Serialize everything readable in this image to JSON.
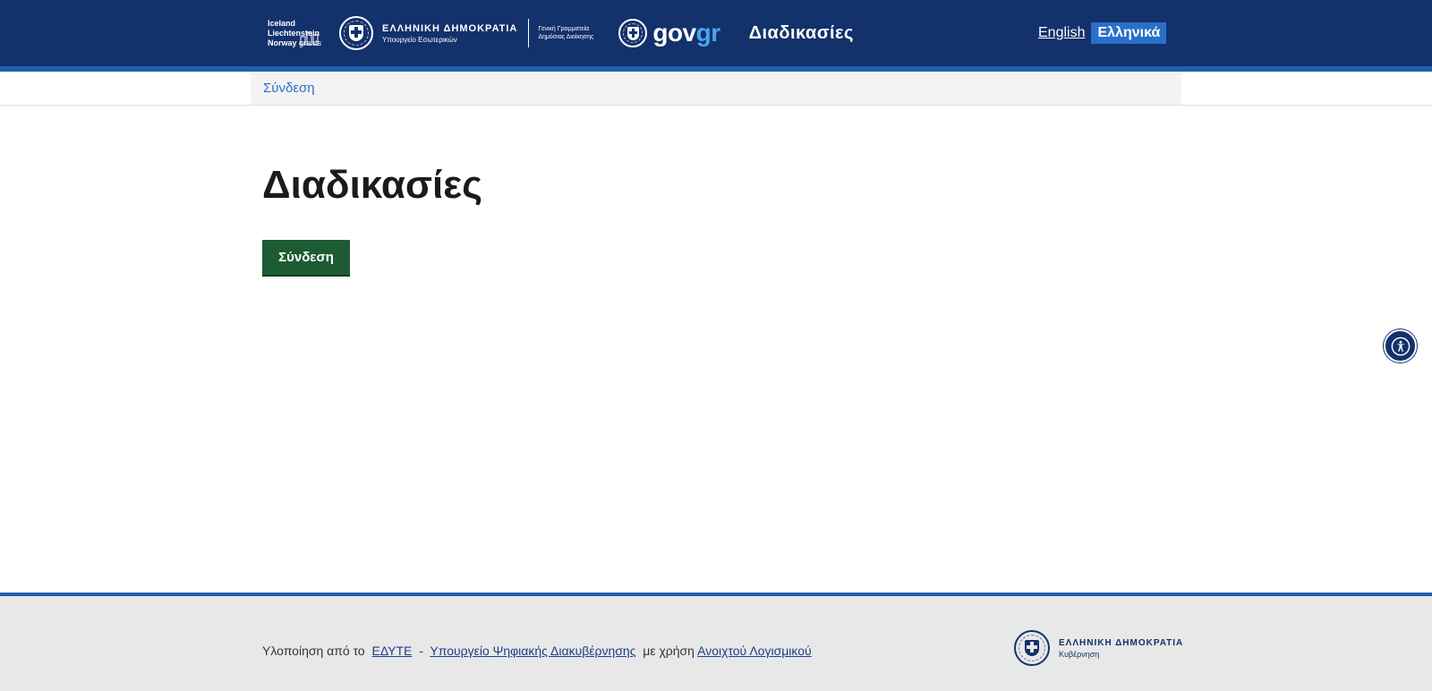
{
  "header": {
    "eea_grants": {
      "line1": "Iceland",
      "line2": "Liechtenstein",
      "line3_bold": "Norway",
      "line3_thin": "grants"
    },
    "ministry": {
      "title": "ΕΛΛΗΝΙΚΗ ΔΗΜΟΚΡΑΤΙΑ",
      "subtitle": "Υπουργείο Εσωτερικών",
      "secretariat_line1": "Γενική Γραμματεία",
      "secretariat_line2": "Δημόσιας Διοίκησης"
    },
    "govgr": {
      "part1": "gov",
      "part2": "gr"
    },
    "title": "Διαδικασίες",
    "languages": {
      "english": "English",
      "greek": "Ελληνικά"
    }
  },
  "breadcrumb": {
    "login_link": "Σύνδεση"
  },
  "main": {
    "title": "Διαδικασίες",
    "login_button": "Σύνδεση"
  },
  "footer": {
    "prefix": "Υλοποίηση από το",
    "link_edyte": "ΕΔΥΤΕ",
    "separator": "-",
    "link_ministry": "Υπουργείο Ψηφιακής Διακυβέρνησης",
    "middle": "με χρήση",
    "link_open_source": "Ανοιχτού Λογισμικού",
    "logo_title": "ΕΛΛΗΝΙΚΗ ΔΗΜΟΚΡΑΤΙΑ",
    "logo_subtitle": "Κυβέρνηση"
  },
  "colors": {
    "header_bg": "#13316b",
    "accent_blue": "#1f5fae",
    "button_green": "#1d5c33",
    "link_blue": "#2a6fc9"
  },
  "icons": {
    "accessibility": "accessibility-icon",
    "seal": "greek-coat-of-arms-icon",
    "eea_logo": "eea-grants-logo-icon"
  }
}
